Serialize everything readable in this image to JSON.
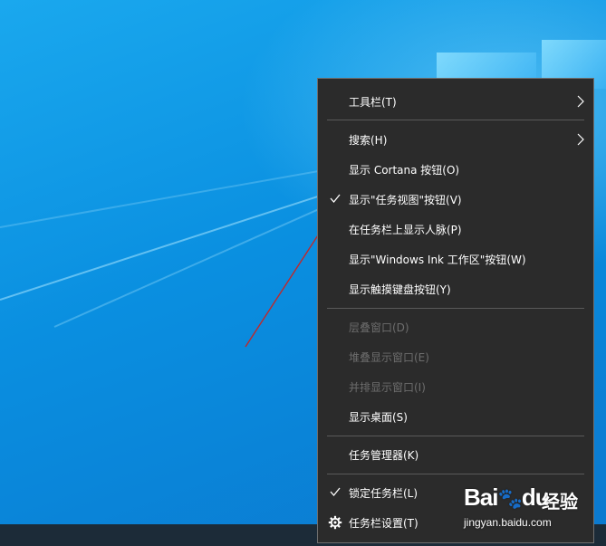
{
  "context_menu": {
    "items": [
      {
        "label": "工具栏(T)",
        "submenu": true,
        "checked": false,
        "disabled": false
      },
      {
        "label": "搜索(H)",
        "submenu": true,
        "checked": false,
        "disabled": false
      },
      {
        "label": "显示 Cortana 按钮(O)",
        "submenu": false,
        "checked": false,
        "disabled": false
      },
      {
        "label": "显示\"任务视图\"按钮(V)",
        "submenu": false,
        "checked": true,
        "disabled": false
      },
      {
        "label": "在任务栏上显示人脉(P)",
        "submenu": false,
        "checked": false,
        "disabled": false
      },
      {
        "label": "显示\"Windows Ink 工作区\"按钮(W)",
        "submenu": false,
        "checked": false,
        "disabled": false
      },
      {
        "label": "显示触摸键盘按钮(Y)",
        "submenu": false,
        "checked": false,
        "disabled": false
      },
      {
        "label": "层叠窗口(D)",
        "submenu": false,
        "checked": false,
        "disabled": true
      },
      {
        "label": "堆叠显示窗口(E)",
        "submenu": false,
        "checked": false,
        "disabled": true
      },
      {
        "label": "并排显示窗口(I)",
        "submenu": false,
        "checked": false,
        "disabled": true
      },
      {
        "label": "显示桌面(S)",
        "submenu": false,
        "checked": false,
        "disabled": false
      },
      {
        "label": "任务管理器(K)",
        "submenu": false,
        "checked": false,
        "disabled": false
      },
      {
        "label": "锁定任务栏(L)",
        "submenu": false,
        "checked": true,
        "disabled": false
      },
      {
        "label": "任务栏设置(T)",
        "submenu": false,
        "checked": false,
        "disabled": false,
        "icon": "gear-icon"
      }
    ]
  },
  "watermark": {
    "logo": "Bai",
    "logo_tail": "du",
    "jingyan": "经验",
    "url": "jingyan.baidu.com"
  },
  "colors": {
    "menu_bg": "#2b2b2b",
    "annotation_arrow": "#c0282a",
    "disabled_text": "#6d6d6d"
  }
}
